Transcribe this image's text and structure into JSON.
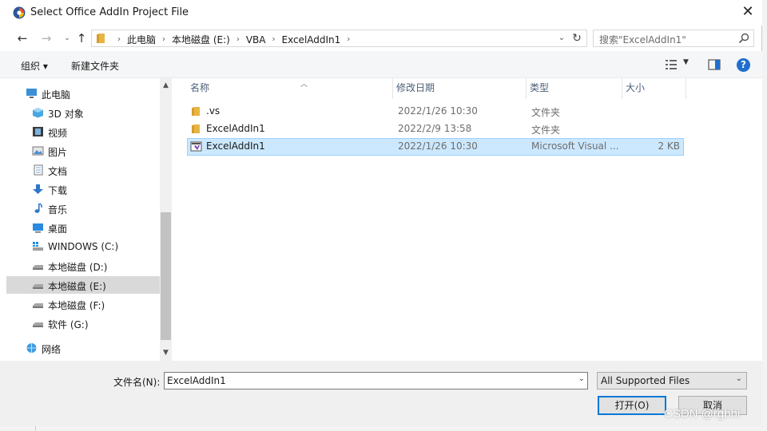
{
  "window": {
    "title": "Select Office AddIn Project File"
  },
  "address": {
    "crumbs": [
      "此电脑",
      "本地磁盘 (E:)",
      "VBA",
      "ExcelAddIn1"
    ],
    "search_placeholder": "搜索\"ExcelAddIn1\""
  },
  "toolbar": {
    "organize": "组织 ▾",
    "new_folder": "新建文件夹"
  },
  "nav": {
    "items": [
      {
        "label": "此电脑",
        "icon": "computer-icon"
      },
      {
        "label": "3D 对象",
        "icon": "3d-objects-icon"
      },
      {
        "label": "视频",
        "icon": "video-icon"
      },
      {
        "label": "图片",
        "icon": "pictures-icon"
      },
      {
        "label": "文档",
        "icon": "documents-icon"
      },
      {
        "label": "下载",
        "icon": "download-icon"
      },
      {
        "label": "音乐",
        "icon": "music-icon"
      },
      {
        "label": "桌面",
        "icon": "desktop-icon"
      },
      {
        "label": "WINDOWS (C:)",
        "icon": "windows-drive-icon"
      },
      {
        "label": "本地磁盘 (D:)",
        "icon": "drive-icon"
      },
      {
        "label": "本地磁盘 (E:)",
        "icon": "drive-icon",
        "selected": true
      },
      {
        "label": "本地磁盘 (F:)",
        "icon": "drive-icon"
      },
      {
        "label": "软件 (G:)",
        "icon": "drive-icon"
      },
      {
        "label": "网络",
        "icon": "network-icon"
      }
    ]
  },
  "columns": {
    "name": "名称",
    "date": "修改日期",
    "type": "类型",
    "size": "大小"
  },
  "files": [
    {
      "name": ".vs",
      "date": "2022/1/26 10:30",
      "type": "文件夹",
      "size": "",
      "icon": "folder-icon"
    },
    {
      "name": "ExcelAddIn1",
      "date": "2022/2/9 13:58",
      "type": "文件夹",
      "size": "",
      "icon": "folder-icon"
    },
    {
      "name": "ExcelAddIn1",
      "date": "2022/1/26 10:30",
      "type": "Microsoft Visual ...",
      "size": "2 KB",
      "icon": "vs-project-icon",
      "selected": true
    }
  ],
  "bottom": {
    "filename_label": "文件名(N):",
    "filename_value": "ExcelAddIn1",
    "filter_value": "All Supported Files",
    "open_label": "打开(O)",
    "cancel_label": "取消"
  },
  "watermark": "CSDN @rgbhi",
  "colors": {
    "accent": "#0078d7",
    "selection": "#cce8ff",
    "folder": "#e8b544"
  }
}
